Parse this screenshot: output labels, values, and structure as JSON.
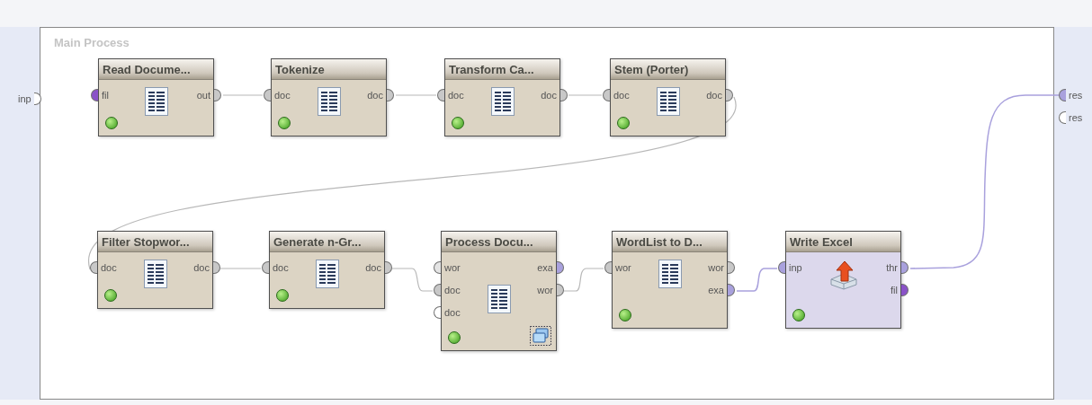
{
  "canvas": {
    "title": "Main Process"
  },
  "process_inputs": [
    {
      "label": "inp",
      "color": "#ffffff"
    }
  ],
  "process_outputs": [
    {
      "label": "res",
      "color": "#a9a1dd"
    },
    {
      "label": "res",
      "color": "#ffffff"
    }
  ],
  "operators": [
    {
      "title": "Read Docume...",
      "kind": "document",
      "color": "#dcd4c4",
      "subprocess": false,
      "inputs": [
        {
          "label": "fil",
          "color": "#8a52c8"
        }
      ],
      "outputs": [
        {
          "label": "out",
          "color": "#c8c8c8"
        }
      ]
    },
    {
      "title": "Tokenize",
      "kind": "document",
      "color": "#dcd4c4",
      "subprocess": false,
      "inputs": [
        {
          "label": "doc",
          "color": "#c8c8c8"
        }
      ],
      "outputs": [
        {
          "label": "doc",
          "color": "#c8c8c8"
        }
      ]
    },
    {
      "title": "Transform Ca...",
      "kind": "document",
      "color": "#dcd4c4",
      "subprocess": false,
      "inputs": [
        {
          "label": "doc",
          "color": "#c8c8c8"
        }
      ],
      "outputs": [
        {
          "label": "doc",
          "color": "#c8c8c8"
        }
      ]
    },
    {
      "title": "Stem (Porter)",
      "kind": "document",
      "color": "#dcd4c4",
      "subprocess": false,
      "inputs": [
        {
          "label": "doc",
          "color": "#c8c8c8"
        }
      ],
      "outputs": [
        {
          "label": "doc",
          "color": "#c8c8c8"
        }
      ]
    },
    {
      "title": "Filter Stopwor...",
      "kind": "document",
      "color": "#dcd4c4",
      "subprocess": false,
      "inputs": [
        {
          "label": "doc",
          "color": "#c8c8c8"
        }
      ],
      "outputs": [
        {
          "label": "doc",
          "color": "#c8c8c8"
        }
      ]
    },
    {
      "title": "Generate n-Gr...",
      "kind": "document",
      "color": "#dcd4c4",
      "subprocess": false,
      "inputs": [
        {
          "label": "doc",
          "color": "#c8c8c8"
        }
      ],
      "outputs": [
        {
          "label": "doc",
          "color": "#c8c8c8"
        }
      ]
    },
    {
      "title": "Process Docu...",
      "kind": "document",
      "color": "#dcd4c4",
      "subprocess": true,
      "inputs": [
        {
          "label": "wor",
          "color": "#e4e4e4"
        },
        {
          "label": "doc",
          "color": "#c8c8c8"
        },
        {
          "label": "doc",
          "color": "#ffffff"
        }
      ],
      "outputs": [
        {
          "label": "exa",
          "color": "#a9a1dd"
        },
        {
          "label": "wor",
          "color": "#c8c8c8"
        }
      ]
    },
    {
      "title": "WordList to D...",
      "kind": "document",
      "color": "#dcd4c4",
      "subprocess": false,
      "inputs": [
        {
          "label": "wor",
          "color": "#c8c8c8"
        }
      ],
      "outputs": [
        {
          "label": "wor",
          "color": "#c8c8c8"
        },
        {
          "label": "exa",
          "color": "#a9a1dd"
        }
      ]
    },
    {
      "title": "Write Excel",
      "kind": "export",
      "color": "#dcd8ec",
      "subprocess": false,
      "inputs": [
        {
          "label": "inp",
          "color": "#a9a1dd"
        }
      ],
      "outputs": [
        {
          "label": "thr",
          "color": "#a9a1dd"
        },
        {
          "label": "fil",
          "color": "#8a52c8"
        }
      ]
    }
  ]
}
